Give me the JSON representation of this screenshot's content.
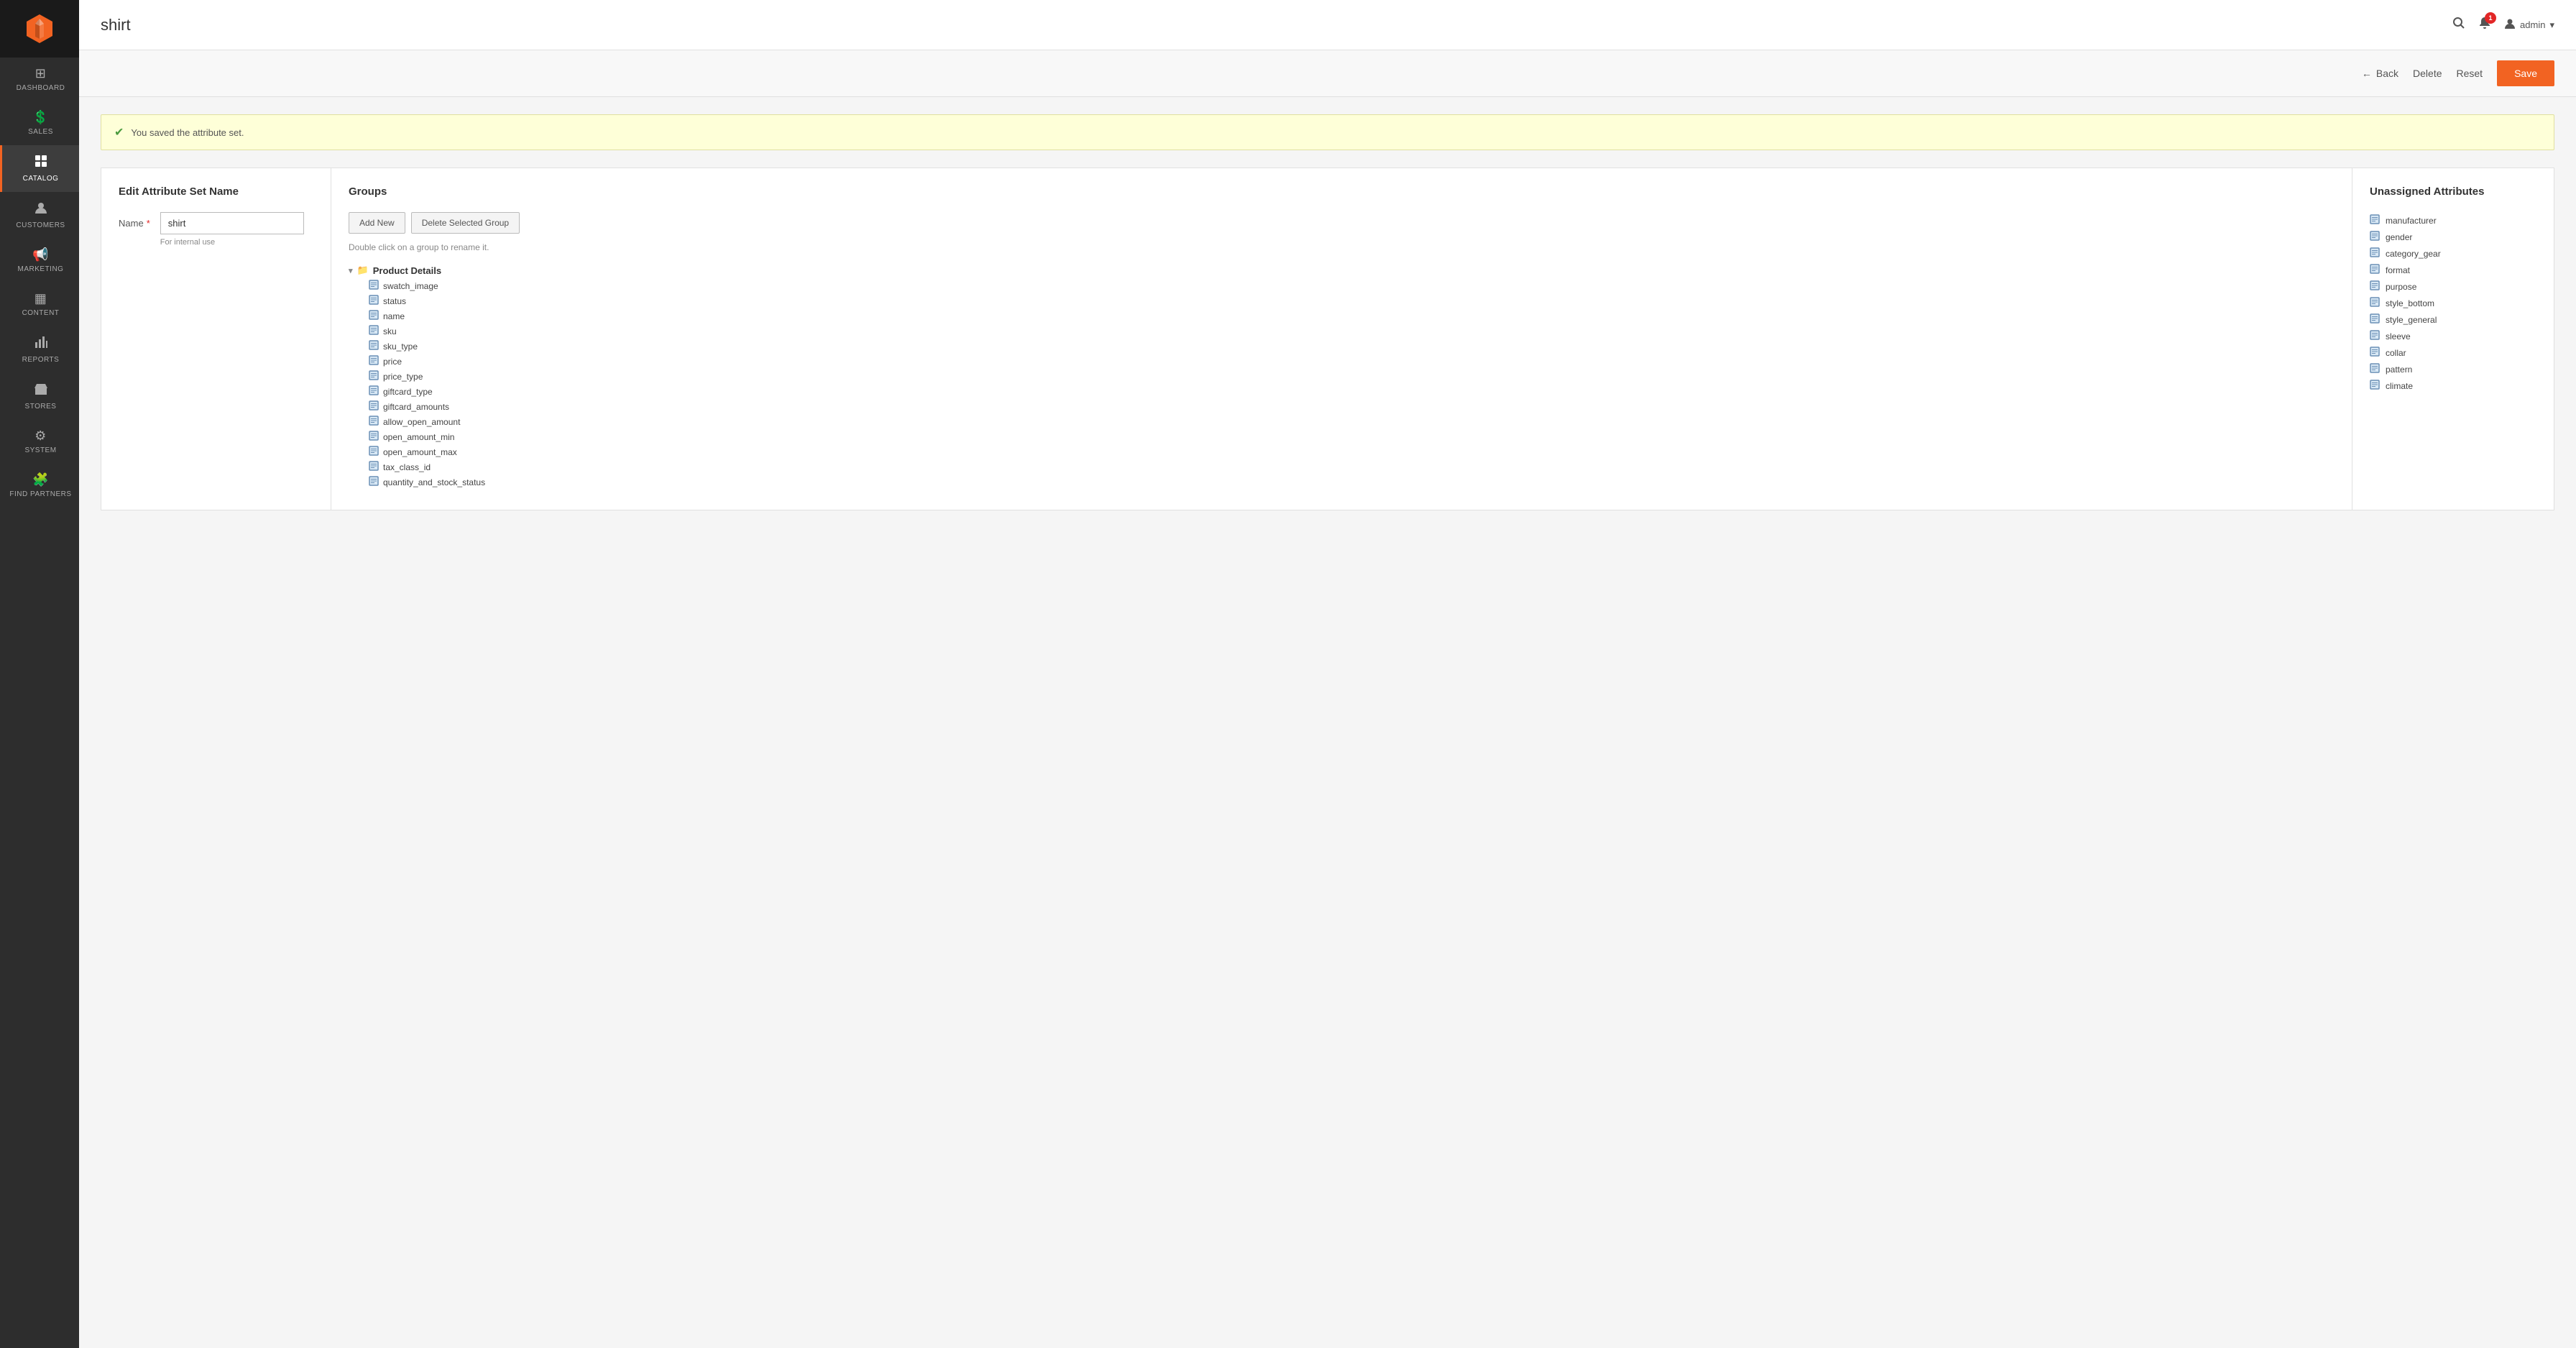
{
  "sidebar": {
    "items": [
      {
        "id": "dashboard",
        "label": "DASHBOARD",
        "icon": "⊞"
      },
      {
        "id": "sales",
        "label": "SALES",
        "icon": "$"
      },
      {
        "id": "catalog",
        "label": "CATALOG",
        "icon": "🗂"
      },
      {
        "id": "customers",
        "label": "CUSTOMERS",
        "icon": "👤"
      },
      {
        "id": "marketing",
        "label": "MARKETING",
        "icon": "📢"
      },
      {
        "id": "content",
        "label": "CONTENT",
        "icon": "▦"
      },
      {
        "id": "reports",
        "label": "REPORTS",
        "icon": "📊"
      },
      {
        "id": "stores",
        "label": "STORES",
        "icon": "🏪"
      },
      {
        "id": "system",
        "label": "SYSTEM",
        "icon": "⚙"
      },
      {
        "id": "find-partners",
        "label": "FIND PARTNERS",
        "icon": "🧩"
      }
    ]
  },
  "header": {
    "page_title": "shirt",
    "notification_count": "1",
    "admin_label": "admin"
  },
  "toolbar": {
    "back_label": "Back",
    "delete_label": "Delete",
    "reset_label": "Reset",
    "save_label": "Save"
  },
  "success_banner": {
    "message": "You saved the attribute set."
  },
  "edit_section": {
    "heading": "Edit Attribute Set Name",
    "name_label": "Name",
    "name_value": "shirt",
    "name_hint": "For internal use"
  },
  "groups_section": {
    "heading": "Groups",
    "add_new_label": "Add New",
    "delete_selected_label": "Delete Selected Group",
    "hint": "Double click on a group to rename it.",
    "tree": {
      "group_name": "Product Details",
      "items": [
        "swatch_image",
        "status",
        "name",
        "sku",
        "sku_type",
        "price",
        "price_type",
        "giftcard_type",
        "giftcard_amounts",
        "allow_open_amount",
        "open_amount_min",
        "open_amount_max",
        "tax_class_id",
        "quantity_and_stock_status"
      ]
    }
  },
  "unassigned_section": {
    "heading": "Unassigned Attributes",
    "items": [
      "manufacturer",
      "gender",
      "category_gear",
      "format",
      "purpose",
      "style_bottom",
      "style_general",
      "sleeve",
      "collar",
      "pattern",
      "climate"
    ]
  }
}
